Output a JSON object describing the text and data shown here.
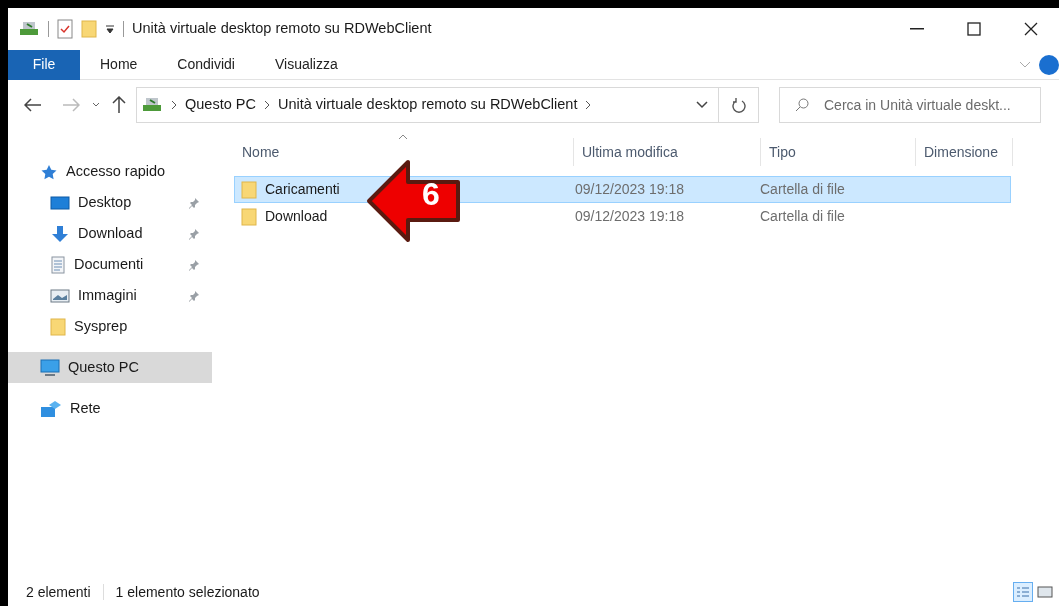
{
  "window": {
    "title": "Unità virtuale desktop remoto su RDWebClient"
  },
  "ribbon_tabs": [
    {
      "label": "File",
      "selected": true
    },
    {
      "label": "Home",
      "selected": false
    },
    {
      "label": "Condividi",
      "selected": false
    },
    {
      "label": "Visualizza",
      "selected": false
    }
  ],
  "address_bar": {
    "path": [
      "Questo PC",
      "Unità virtuale desktop remoto su RDWebClient"
    ]
  },
  "search": {
    "placeholder": "Cerca in Unità virtuale deskt..."
  },
  "nav": [
    {
      "label": "Accesso rapido",
      "kind": "star",
      "selected": false,
      "children": [
        {
          "label": "Desktop",
          "kind": "desktop",
          "pinned": true,
          "selected": false
        },
        {
          "label": "Download",
          "kind": "download",
          "pinned": true,
          "selected": false
        },
        {
          "label": "Documenti",
          "kind": "document",
          "pinned": true,
          "selected": false
        },
        {
          "label": "Immagini",
          "kind": "pictures",
          "pinned": true,
          "selected": false
        },
        {
          "label": "Sysprep",
          "kind": "folder",
          "pinned": false,
          "selected": false
        }
      ]
    },
    {
      "label": "Questo PC",
      "kind": "pc",
      "selected": true
    },
    {
      "label": "Rete",
      "kind": "network",
      "selected": false
    }
  ],
  "table": {
    "columns": [
      "Nome",
      "Ultima modifica",
      "Tipo",
      "Dimensione"
    ],
    "rows": [
      {
        "name": "Caricamenti",
        "modified": "09/12/2023 19:18",
        "type": "Cartella di file",
        "selected": true
      },
      {
        "name": "Download",
        "modified": "09/12/2023 19:18",
        "type": "Cartella di file",
        "selected": false
      }
    ]
  },
  "annotation": {
    "label": "6"
  },
  "status_bar": {
    "items": [
      "2 elementi",
      "1 elemento selezionato"
    ]
  }
}
